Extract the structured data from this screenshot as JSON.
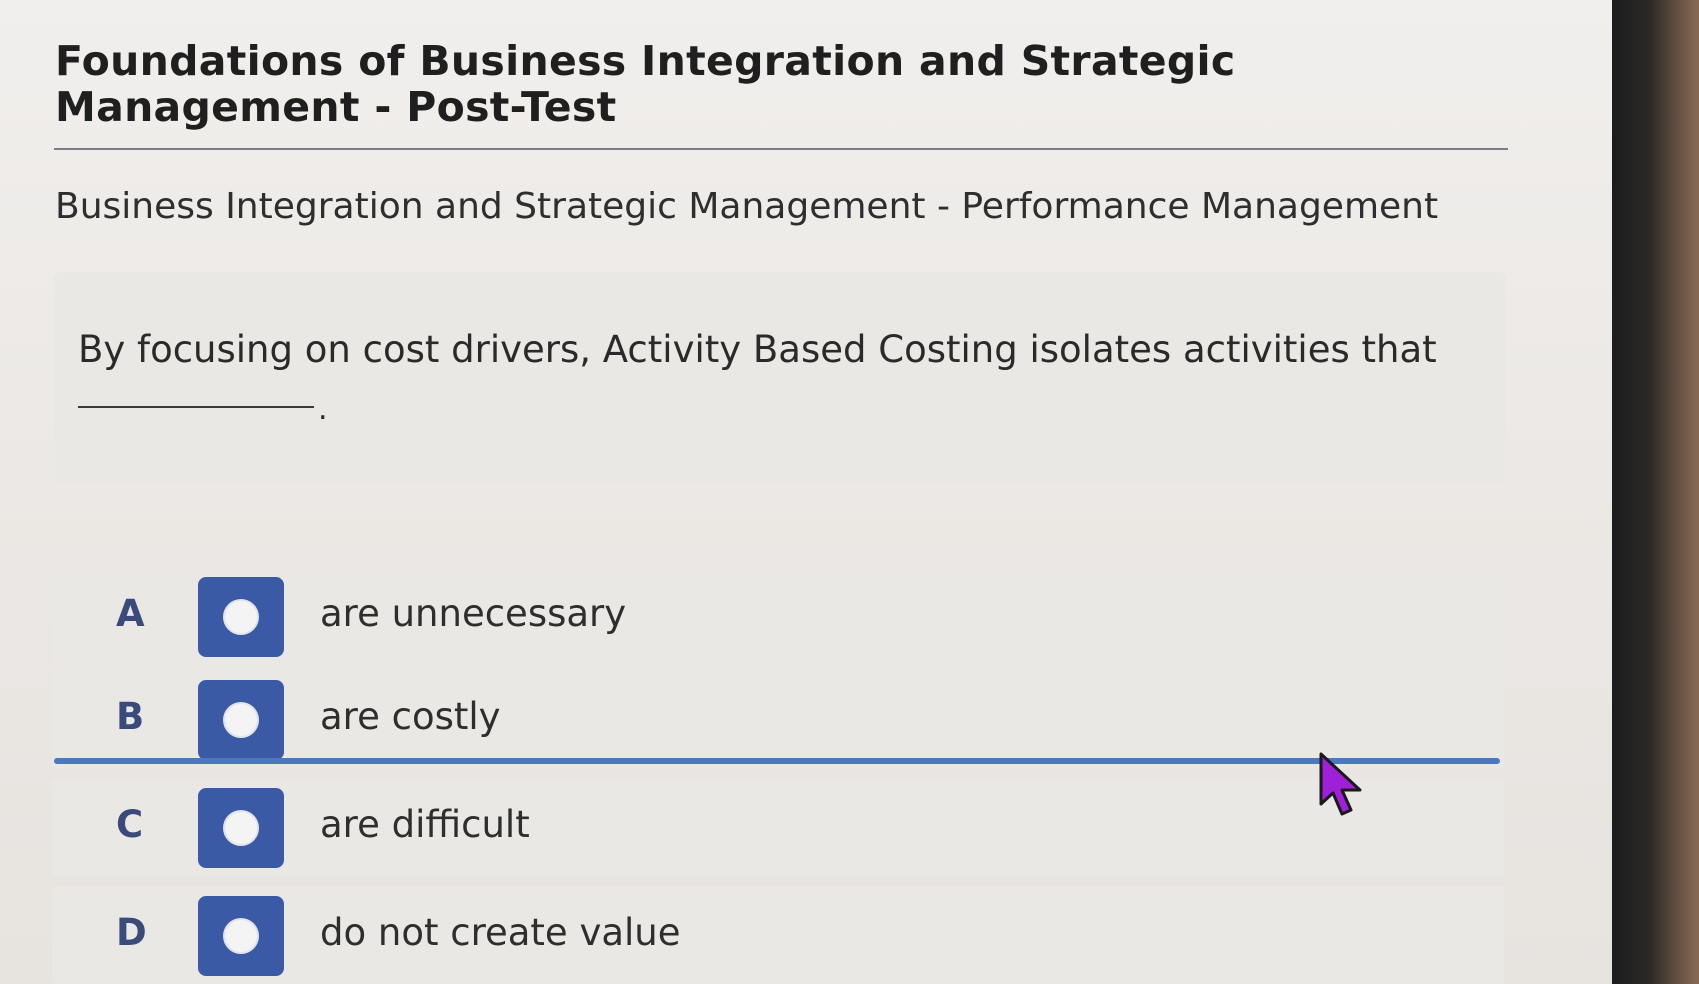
{
  "page": {
    "title": "Foundations of Business Integration and Strategic Management - Post-Test",
    "subtitle": "Business Integration and Strategic Management - Performance Management"
  },
  "question": {
    "text": "By focusing on cost drivers, Activity Based Costing isolates activities that",
    "blank_terminator": "."
  },
  "options": [
    {
      "letter": "A",
      "text": "are unnecessary",
      "selected": false
    },
    {
      "letter": "B",
      "text": "are costly",
      "selected": false
    },
    {
      "letter": "C",
      "text": "are difficult",
      "selected": false
    },
    {
      "letter": "D",
      "text": "do not create value",
      "selected": false
    }
  ],
  "colors": {
    "radio_background": "#3b5aa5",
    "focus_line": "#4a79c0",
    "cursor": "#a01fd8",
    "letter": "#3a4a7a"
  },
  "icons": {
    "radio": "radio-button-icon",
    "cursor": "mouse-pointer-icon"
  }
}
